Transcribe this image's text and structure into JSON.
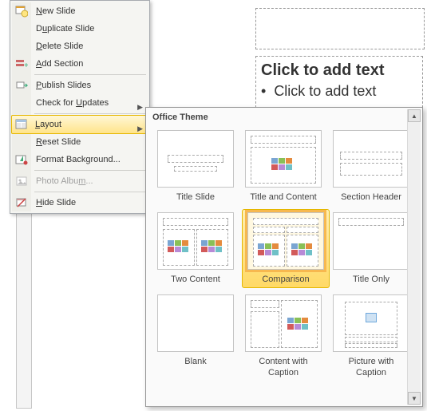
{
  "slide": {
    "add_text": "Click to add text",
    "bullet_text": "Click to add text"
  },
  "context_menu": {
    "items": [
      {
        "label_pre": "",
        "u": "N",
        "label_post": "ew Slide",
        "icon": "new-slide",
        "has_arrow": false,
        "disabled": false
      },
      {
        "label_pre": "D",
        "u": "u",
        "label_post": "plicate Slide",
        "icon": "",
        "has_arrow": false,
        "disabled": false
      },
      {
        "label_pre": "",
        "u": "D",
        "label_post": "elete Slide",
        "icon": "",
        "has_arrow": false,
        "disabled": false
      },
      {
        "label_pre": "",
        "u": "A",
        "label_post": "dd Section",
        "icon": "add-section",
        "has_arrow": false,
        "disabled": false
      },
      {
        "sep": true
      },
      {
        "label_pre": "",
        "u": "P",
        "label_post": "ublish Slides",
        "icon": "publish",
        "has_arrow": false,
        "disabled": false
      },
      {
        "label_pre": "Check for ",
        "u": "U",
        "label_post": "pdates",
        "icon": "",
        "has_arrow": true,
        "disabled": false
      },
      {
        "sep": true
      },
      {
        "label_pre": "",
        "u": "L",
        "label_post": "ayout",
        "icon": "layout",
        "has_arrow": true,
        "disabled": false,
        "hover": true
      },
      {
        "label_pre": "",
        "u": "R",
        "label_post": "eset Slide",
        "icon": "",
        "has_arrow": false,
        "disabled": false
      },
      {
        "label_pre": "Format Back",
        "u": "g",
        "label_post": "round...",
        "icon": "format-bg",
        "has_arrow": false,
        "disabled": false
      },
      {
        "sep": true
      },
      {
        "label_pre": "Photo Albu",
        "u": "m",
        "label_post": "...",
        "icon": "photo-album",
        "has_arrow": false,
        "disabled": true
      },
      {
        "sep": true
      },
      {
        "label_pre": "",
        "u": "H",
        "label_post": "ide Slide",
        "icon": "hide-slide",
        "has_arrow": false,
        "disabled": false
      }
    ]
  },
  "layout_gallery": {
    "header": "Office Theme",
    "layouts": [
      {
        "name": "Title Slide",
        "kind": "title"
      },
      {
        "name": "Title and Content",
        "kind": "title-content"
      },
      {
        "name": "Section Header",
        "kind": "section"
      },
      {
        "name": "Two Content",
        "kind": "two-content"
      },
      {
        "name": "Comparison",
        "kind": "comparison",
        "selected": true
      },
      {
        "name": "Title Only",
        "kind": "title-only"
      },
      {
        "name": "Blank",
        "kind": "blank"
      },
      {
        "name": "Content with Caption",
        "kind": "content-caption"
      },
      {
        "name": "Picture with Caption",
        "kind": "picture-caption"
      }
    ]
  }
}
